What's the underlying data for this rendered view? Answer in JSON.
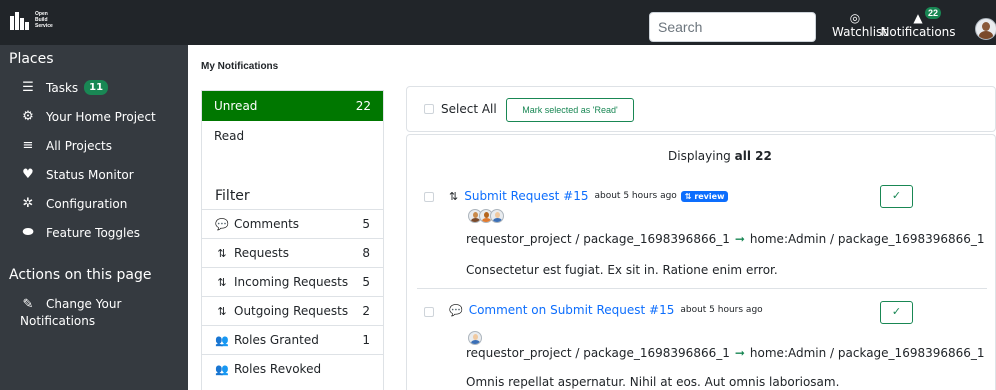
{
  "header": {
    "logo_lines": [
      "Open",
      "Build",
      "Service"
    ],
    "search_placeholder": "Search",
    "watchlist_label": "Watchlist",
    "notifications_label": "Notifications",
    "notifications_count": "22"
  },
  "sidebar": {
    "places_heading": "Places",
    "items": [
      {
        "label": "Tasks",
        "badge": "11",
        "icon": "tasks-icon"
      },
      {
        "label": "Your Home Project",
        "icon": "home-project-icon"
      },
      {
        "label": "All Projects",
        "icon": "list-icon"
      },
      {
        "label": "Status Monitor",
        "icon": "heartbeat-icon"
      },
      {
        "label": "Configuration",
        "icon": "cogs-icon"
      },
      {
        "label": "Feature Toggles",
        "icon": "toggle-icon"
      }
    ],
    "actions_heading": "Actions on this page",
    "actions": [
      {
        "label_line1": "Change Your",
        "label_line2": "Notifications",
        "icon": "edit-icon"
      }
    ]
  },
  "main": {
    "title": "My Notifications",
    "tabs": [
      {
        "label": "Unread",
        "count": "22",
        "active": true
      },
      {
        "label": "Read",
        "count": "",
        "active": false
      }
    ],
    "filter_title": "Filter",
    "filters": [
      {
        "label": "Comments",
        "count": "5",
        "icon": "comments-icon"
      },
      {
        "label": "Requests",
        "count": "8",
        "icon": "request-icon"
      },
      {
        "label": "Incoming Requests",
        "count": "5",
        "icon": "request-icon"
      },
      {
        "label": "Outgoing Requests",
        "count": "2",
        "icon": "request-icon"
      },
      {
        "label": "Roles Granted",
        "count": "1",
        "icon": "user-group-icon"
      },
      {
        "label": "Roles Revoked",
        "count": "",
        "icon": "user-group-icon"
      }
    ],
    "select_all_label": "Select All",
    "mark_read_label": "Mark selected as 'Read'",
    "displaying_prefix": "Displaying",
    "displaying_count": "all 22",
    "notifications": [
      {
        "title": "Submit Request #15",
        "time": "about 5 hours ago",
        "badge": "review",
        "source": "requestor_project / package_1698396866_1",
        "target": "home:Admin / package_1698396866_1",
        "description": "Consectetur est fugiat. Ex sit in. Ratione enim error."
      },
      {
        "title": "Comment on Submit Request #15",
        "time": "about 5 hours ago",
        "badge": "",
        "source": "requestor_project / package_1698396866_1",
        "target": "home:Admin / package_1698396866_1",
        "description": "Omnis repellat aspernatur. Nihil at eos. Aut omnis laboriosam."
      }
    ]
  },
  "colors": {
    "navbar": "#212529",
    "sidebar": "#353a40",
    "active_tab": "#007700",
    "success": "#198754",
    "link": "#0d6efd"
  }
}
